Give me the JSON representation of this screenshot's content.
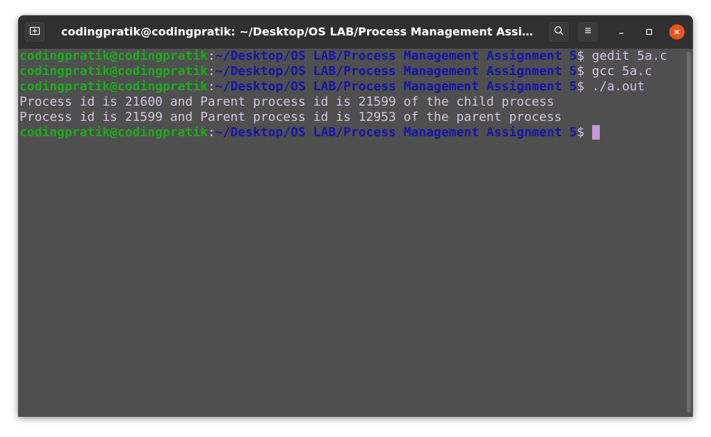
{
  "window": {
    "title": "codingpratik@codingpratik: ~/Desktop/OS LAB/Process Management Assig…"
  },
  "titlebar": {
    "new_tab_icon": "new-tab-icon",
    "search_icon": "search-icon",
    "menu_icon": "hamburger-menu-icon",
    "minimize_icon": "minimize-icon",
    "maximize_icon": "maximize-icon",
    "close_icon": "close-icon"
  },
  "colors": {
    "title_bar": "#303030",
    "terminal_bg": "#4f4f4f",
    "prompt_user": "#1ea91e",
    "prompt_path": "#1515a8",
    "text": "#d6c3e3",
    "cursor": "#c49ad8",
    "close_button": "#e95420"
  },
  "terminal": {
    "prompt_user": "codingpratik@codingpratik",
    "prompt_colon": ":",
    "prompt_path": "~/Desktop/OS LAB/Process Management Assignment 5",
    "prompt_dollar": "$ ",
    "commands": [
      "gedit 5a.c",
      "gcc 5a.c",
      "./a.out"
    ],
    "output": [
      "Process id is 21600 and Parent process id is 21599 of the child process",
      "Process id is 21599 and Parent process id is 12953 of the parent process"
    ]
  }
}
